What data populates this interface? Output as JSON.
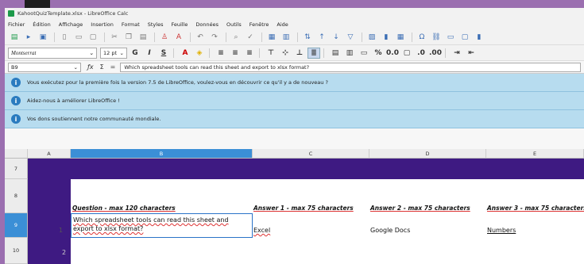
{
  "window": {
    "title": "KahootQuizTemplate.xlsx - LibreOffice Calc"
  },
  "menu": [
    "Fichier",
    "Édition",
    "Affichage",
    "Insertion",
    "Format",
    "Styles",
    "Feuille",
    "Données",
    "Outils",
    "Fenêtre",
    "Aide"
  ],
  "format": {
    "font": "Montserrat",
    "size": "12 pt"
  },
  "formula": {
    "cell_ref": "B9",
    "content": "Which spreadsheet tools can read this sheet and export to xlsx format?"
  },
  "infobars": [
    "Vous exécutez pour la première fois la version 7.5 de LibreOffice, voulez-vous en découvrir ce qu'il y a de nouveau ?",
    "Aidez-nous à améliorer LibreOffice !",
    "Vos dons soutiennent notre communauté mondiale."
  ],
  "columns": [
    "A",
    "B",
    "C",
    "D",
    "E"
  ],
  "rows": [
    "7",
    "8",
    "9",
    "10"
  ],
  "sheet": {
    "headers": {
      "question": "Question - max 120 characters",
      "answer1": "Answer 1 - max 75 characters",
      "answer2": "Answer 2 - max 75 characters",
      "answer3": "Answer 3 - max 75 characters"
    },
    "row9": {
      "index": "1",
      "question": "Which spreadsheet tools can read this sheet and export to xlsx format?",
      "answer1": "Excel",
      "answer2": "Google Docs",
      "answer3": "Numbers"
    },
    "row10": {
      "index": "2"
    }
  },
  "colors": {
    "purple": "#3e1a82",
    "selection": "#3b8fd6",
    "infobar": "#b7dcef"
  }
}
